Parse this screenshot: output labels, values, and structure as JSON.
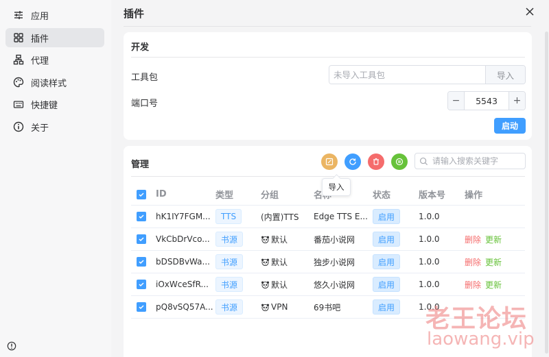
{
  "sidebar": {
    "items": [
      {
        "label": "应用",
        "icon": "sliders-icon"
      },
      {
        "label": "插件",
        "icon": "grid-icon"
      },
      {
        "label": "代理",
        "icon": "network-icon"
      },
      {
        "label": "阅读样式",
        "icon": "palette-icon"
      },
      {
        "label": "快捷键",
        "icon": "keyboard-icon"
      },
      {
        "label": "关于",
        "icon": "info-icon"
      }
    ],
    "active_index": 1
  },
  "header": {
    "title": "插件"
  },
  "dev": {
    "title": "开发",
    "toolkit_label": "工具包",
    "toolkit_placeholder": "未导入工具包",
    "import_label": "导入",
    "port_label": "端口号",
    "port_value": "5543",
    "minus": "−",
    "plus": "+",
    "start_label": "启动"
  },
  "manage": {
    "title": "管理",
    "search_placeholder": "请输入搜索关键字",
    "tooltip": "导入",
    "toolbar_colors": {
      "import": "#ebb563",
      "refresh": "#409eff",
      "delete": "#f56c6c",
      "other": "#67c23a"
    },
    "columns": [
      "ID",
      "类型",
      "分组",
      "名称",
      "状态",
      "版本号",
      "操作"
    ],
    "rows": [
      {
        "id": "hK1IY7FGM...",
        "type": "TTS",
        "group": "(内置)TTS",
        "group_icon": false,
        "name": "Edge TTS E...",
        "status": "启用",
        "version": "1.0.0",
        "delete": "",
        "update": ""
      },
      {
        "id": "VkCbDrVco...",
        "type": "书源",
        "group": "默认",
        "group_icon": true,
        "name": "番茄小说网",
        "status": "启用",
        "version": "1.0.0",
        "delete": "删除",
        "update": "更新"
      },
      {
        "id": "bDSDBvWa...",
        "type": "书源",
        "group": "默认",
        "group_icon": true,
        "name": "独步小说网",
        "status": "启用",
        "version": "1.0.0",
        "delete": "删除",
        "update": "更新"
      },
      {
        "id": "iOxWceSfR...",
        "type": "书源",
        "group": "默认",
        "group_icon": true,
        "name": "悠久小说网",
        "status": "启用",
        "version": "1.0.0",
        "delete": "删除",
        "update": "更新"
      },
      {
        "id": "pQ8vSQ57A...",
        "type": "书源",
        "group": "VPN",
        "group_icon": true,
        "name": "69书吧",
        "status": "启用",
        "version": "1.0.0",
        "delete": "",
        "update": ""
      }
    ]
  },
  "watermark": {
    "line1": "老王论坛",
    "line2": "laowang.vip"
  }
}
